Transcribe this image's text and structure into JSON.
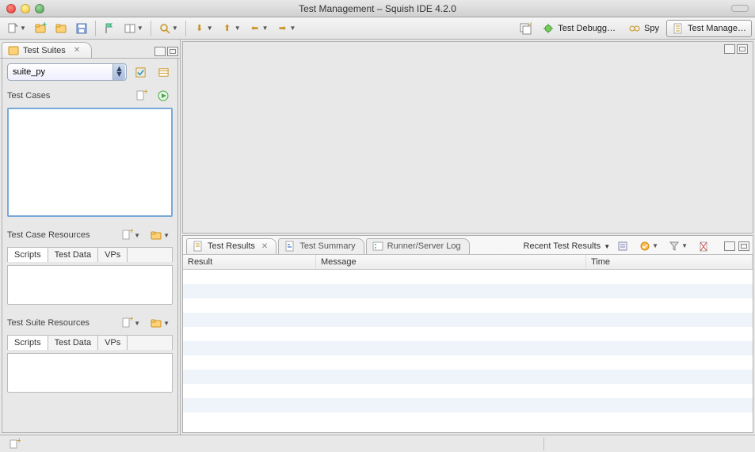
{
  "window": {
    "title": "Test Management – Squish IDE 4.2.0"
  },
  "perspectives": {
    "debug": "Test Debugg…",
    "spy": "Spy",
    "manage": "Test Manage…"
  },
  "sidebar": {
    "tab_label": "Test Suites",
    "suite_selected": "suite_py",
    "test_cases_label": "Test Cases",
    "tc_resources_label": "Test Case Resources",
    "ts_resources_label": "Test Suite Resources",
    "sub_tabs": {
      "scripts": "Scripts",
      "testdata": "Test Data",
      "vps": "VPs"
    }
  },
  "bottom": {
    "tabs": {
      "results": "Test Results",
      "summary": "Test Summary",
      "log": "Runner/Server Log"
    },
    "recent_label": "Recent Test Results",
    "columns": {
      "result": "Result",
      "message": "Message",
      "time": "Time"
    }
  }
}
